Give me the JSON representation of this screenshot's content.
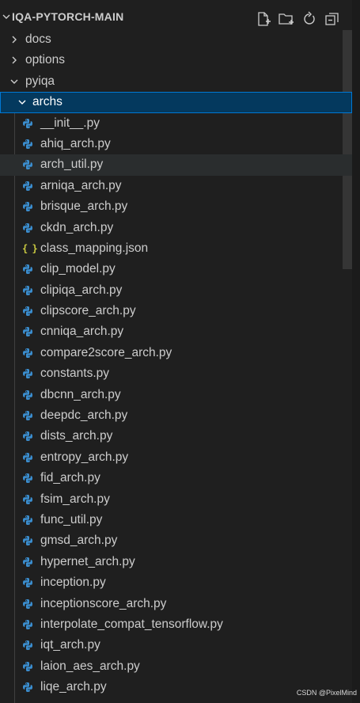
{
  "explorer": {
    "title": "IQA-PYTORCH-MAIN",
    "actions": [
      {
        "name": "new-file-icon"
      },
      {
        "name": "new-folder-icon"
      },
      {
        "name": "refresh-icon"
      },
      {
        "name": "collapse-all-icon"
      }
    ]
  },
  "tree": {
    "folders": {
      "docs": "docs",
      "options": "options",
      "pyiqa": "pyiqa",
      "archs": "archs"
    },
    "files": [
      {
        "label": "__init__.py",
        "type": "python"
      },
      {
        "label": "ahiq_arch.py",
        "type": "python"
      },
      {
        "label": "arch_util.py",
        "type": "python"
      },
      {
        "label": "arniqa_arch.py",
        "type": "python"
      },
      {
        "label": "brisque_arch.py",
        "type": "python"
      },
      {
        "label": "ckdn_arch.py",
        "type": "python"
      },
      {
        "label": "class_mapping.json",
        "type": "json",
        "icon": "{ }"
      },
      {
        "label": "clip_model.py",
        "type": "python"
      },
      {
        "label": "clipiqa_arch.py",
        "type": "python"
      },
      {
        "label": "clipscore_arch.py",
        "type": "python"
      },
      {
        "label": "cnniqa_arch.py",
        "type": "python"
      },
      {
        "label": "compare2score_arch.py",
        "type": "python"
      },
      {
        "label": "constants.py",
        "type": "python"
      },
      {
        "label": "dbcnn_arch.py",
        "type": "python"
      },
      {
        "label": "deepdc_arch.py",
        "type": "python"
      },
      {
        "label": "dists_arch.py",
        "type": "python"
      },
      {
        "label": "entropy_arch.py",
        "type": "python"
      },
      {
        "label": "fid_arch.py",
        "type": "python"
      },
      {
        "label": "fsim_arch.py",
        "type": "python"
      },
      {
        "label": "func_util.py",
        "type": "python"
      },
      {
        "label": "gmsd_arch.py",
        "type": "python"
      },
      {
        "label": "hypernet_arch.py",
        "type": "python"
      },
      {
        "label": "inception.py",
        "type": "python"
      },
      {
        "label": "inceptionscore_arch.py",
        "type": "python"
      },
      {
        "label": "interpolate_compat_tensorflow.py",
        "type": "python"
      },
      {
        "label": "iqt_arch.py",
        "type": "python"
      },
      {
        "label": "laion_aes_arch.py",
        "type": "python"
      },
      {
        "label": "liqe_arch.py",
        "type": "python"
      }
    ]
  },
  "colors": {
    "background": "#1f1f1f",
    "selection": "#04395e",
    "focus_border": "#0078d4",
    "hover": "#2a2d2e",
    "python_icon": "#3b8fd1",
    "json_icon": "#cbcb41"
  },
  "watermark": "CSDN @PixelMind"
}
